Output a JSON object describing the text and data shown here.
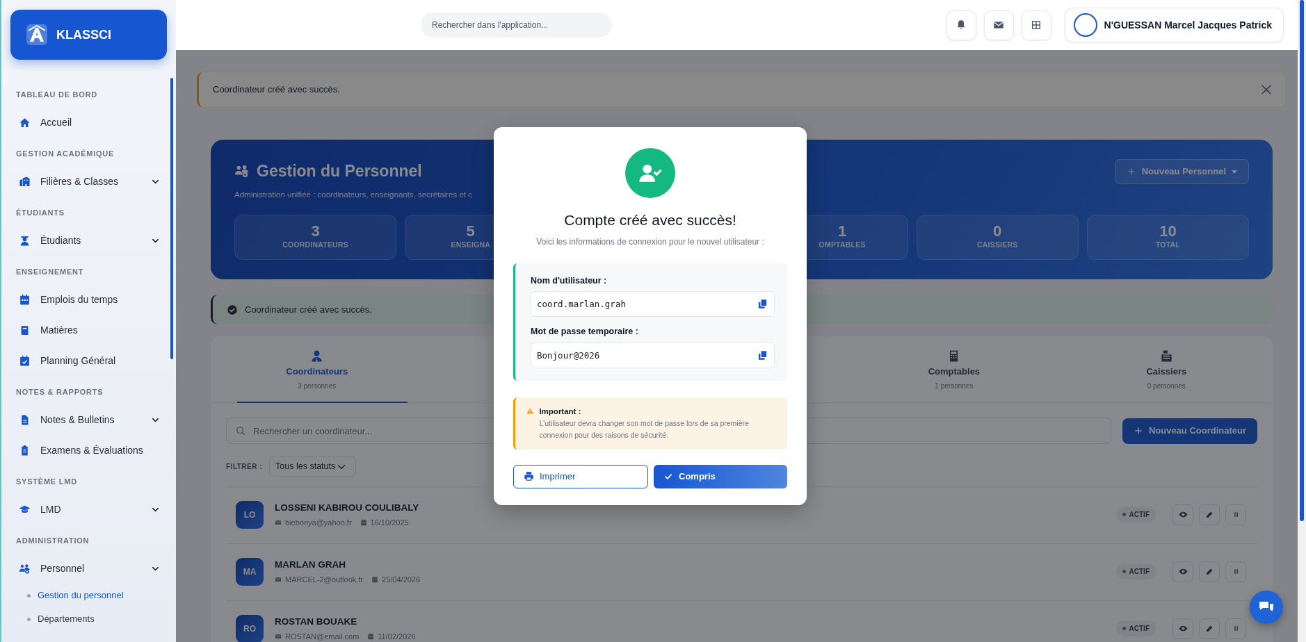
{
  "sidebar": {
    "brand": "KLASSCI",
    "sections": [
      {
        "title": "TABLEAU DE BORD",
        "items": [
          {
            "label": "Accueil",
            "has_submenu": false
          }
        ]
      },
      {
        "title": "GESTION ACADÉMIQUE",
        "items": [
          {
            "label": "Filières & Classes",
            "has_submenu": true
          }
        ]
      },
      {
        "title": "ÉTUDIANTS",
        "items": [
          {
            "label": "Étudiants",
            "has_submenu": true
          }
        ]
      },
      {
        "title": "ENSEIGNEMENT",
        "items": [
          {
            "label": "Emplois du temps",
            "has_submenu": false
          },
          {
            "label": "Matières",
            "has_submenu": false
          },
          {
            "label": "Planning Général",
            "has_submenu": false
          }
        ]
      },
      {
        "title": "NOTES & RAPPORTS",
        "items": [
          {
            "label": "Notes & Bulletins",
            "has_submenu": true
          },
          {
            "label": "Examens & Évaluations",
            "has_submenu": false
          }
        ]
      },
      {
        "title": "SYSTÈME LMD",
        "items": [
          {
            "label": "LMD",
            "has_submenu": true
          }
        ]
      },
      {
        "title": "ADMINISTRATION",
        "items": [
          {
            "label": "Personnel",
            "has_submenu": true,
            "children": [
              {
                "label": "Gestion du personnel",
                "selected": true
              },
              {
                "label": "Départements",
                "selected": false
              }
            ]
          }
        ]
      }
    ]
  },
  "header": {
    "search": {
      "placeholder": "Rechercher dans l'application..."
    },
    "user": {
      "name": "N'GUESSAN Marcel Jacques Patrick"
    }
  },
  "top_alert": {
    "text": "Coordinateur créé avec succès."
  },
  "hero": {
    "title": "Gestion du Personnel",
    "subtitle": "Administration unifiée : coordinateurs, enseignants, secrétaires et c",
    "button": "Nouveau Personnel",
    "stats": [
      {
        "value": "3",
        "label": "COORDINATEURS"
      },
      {
        "value": "5",
        "label": "ENSEIGNA"
      },
      {
        "value": "1",
        "label": "OMPTABLES"
      },
      {
        "value": "0",
        "label": "CAISSIERS"
      },
      {
        "value": "10",
        "label": "TOTAL"
      }
    ]
  },
  "success_alert": {
    "text": "Coordinateur créé avec succès."
  },
  "tabs": [
    {
      "label": "Coordinateurs",
      "count": "3 personnes",
      "selected": true
    },
    {
      "label": "Comptables",
      "count": "1 personnes",
      "selected": false
    },
    {
      "label": "Caissiers",
      "count": "0 personnes",
      "selected": false
    }
  ],
  "list_search": {
    "placeholder": "Rechercher un coordinateur..."
  },
  "new_button": "Nouveau Coordinateur",
  "filter": {
    "label": "FILTRER :",
    "value": "Tous les statuts"
  },
  "rows": [
    {
      "initials": "LO",
      "name": "LOSSENI KABIROU COULIBALY",
      "email": "biebonya@yahoo.fr",
      "date": "16/10/2025",
      "status": "ACTIF"
    },
    {
      "initials": "MA",
      "name": "MARLAN GRAH",
      "email": "MARCEL-2@outlook.fr",
      "date": "25/04/2026",
      "status": "ACTIF"
    },
    {
      "initials": "RO",
      "name": "ROSTAN BOUAKE",
      "email": "ROSTAN@email.com",
      "date": "11/02/2026",
      "status": "ACTIF"
    }
  ],
  "modal": {
    "title": "Compte créé avec succès!",
    "subtitle": "Voici les informations de connexion pour le nouvel utilisateur :",
    "credentials": [
      {
        "label": "Nom d'utilisateur :",
        "value": "coord.marlan.grah"
      },
      {
        "label": "Mot de passe temporaire :",
        "value": "Bonjour@2026"
      }
    ],
    "warning": {
      "title": "Important :",
      "text": "L'utilisateur devra changer son mot de passe lors de sa première connexion pour des raisons de sécurité."
    },
    "print_button": "Imprimer",
    "confirm_button": "Compris"
  }
}
